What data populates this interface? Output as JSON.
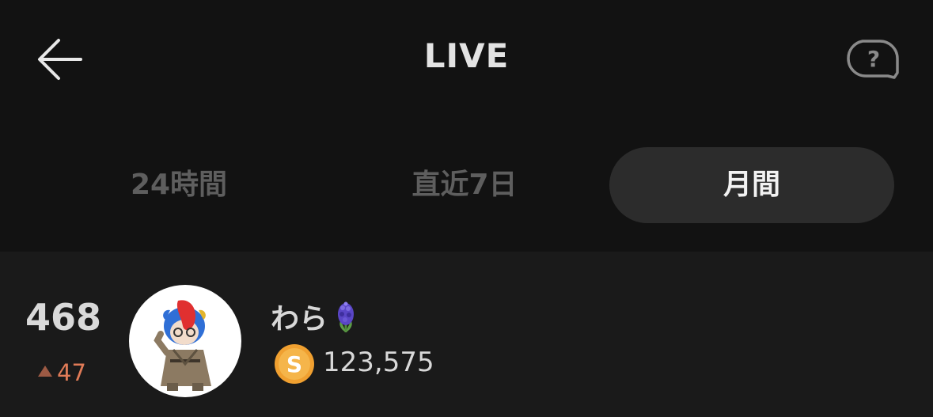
{
  "header": {
    "title": "LIVE",
    "back_icon": "arrow-left-icon",
    "help_icon": "question-bubble-icon"
  },
  "tabs": [
    {
      "label": "24時間",
      "active": false
    },
    {
      "label": "直近7日",
      "active": false
    },
    {
      "label": "月間",
      "active": true
    }
  ],
  "ranking": [
    {
      "rank": "468",
      "change": "47",
      "change_direction": "up",
      "name": "わら",
      "name_emoji": "hyacinth-icon",
      "coin_icon": "s-coin-icon",
      "points": "123,575"
    }
  ],
  "colors": {
    "background": "#121212",
    "active_tab_bg": "#2c2c2c",
    "row_bg": "#1a1a1a",
    "rank_up": "#e07b57",
    "coin": "#f0a030"
  }
}
